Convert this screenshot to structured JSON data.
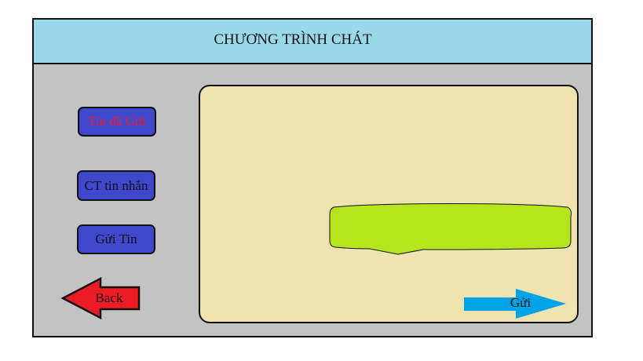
{
  "header": {
    "title": "CHƯƠNG TRÌNH CHÁT"
  },
  "sidebar": {
    "items": [
      {
        "label": "Tin đã Gửi",
        "text_color": "#ed1c24"
      },
      {
        "label": "CT tin nhắn",
        "text_color": "#111111"
      },
      {
        "label": "Gửi Tin",
        "text_color": "#111111"
      }
    ],
    "back_label": "Back"
  },
  "chat": {
    "bubble_text": "",
    "send_label": "Gửi"
  },
  "colors": {
    "header_bg": "#99d9ea",
    "frame_bg": "#c3c3c3",
    "button_bg": "#3f48cc",
    "back_arrow": "#ed1c24",
    "chat_panel_bg": "#efe4b0",
    "bubble_bg": "#b5e61d",
    "send_arrow": "#00a2e8"
  }
}
